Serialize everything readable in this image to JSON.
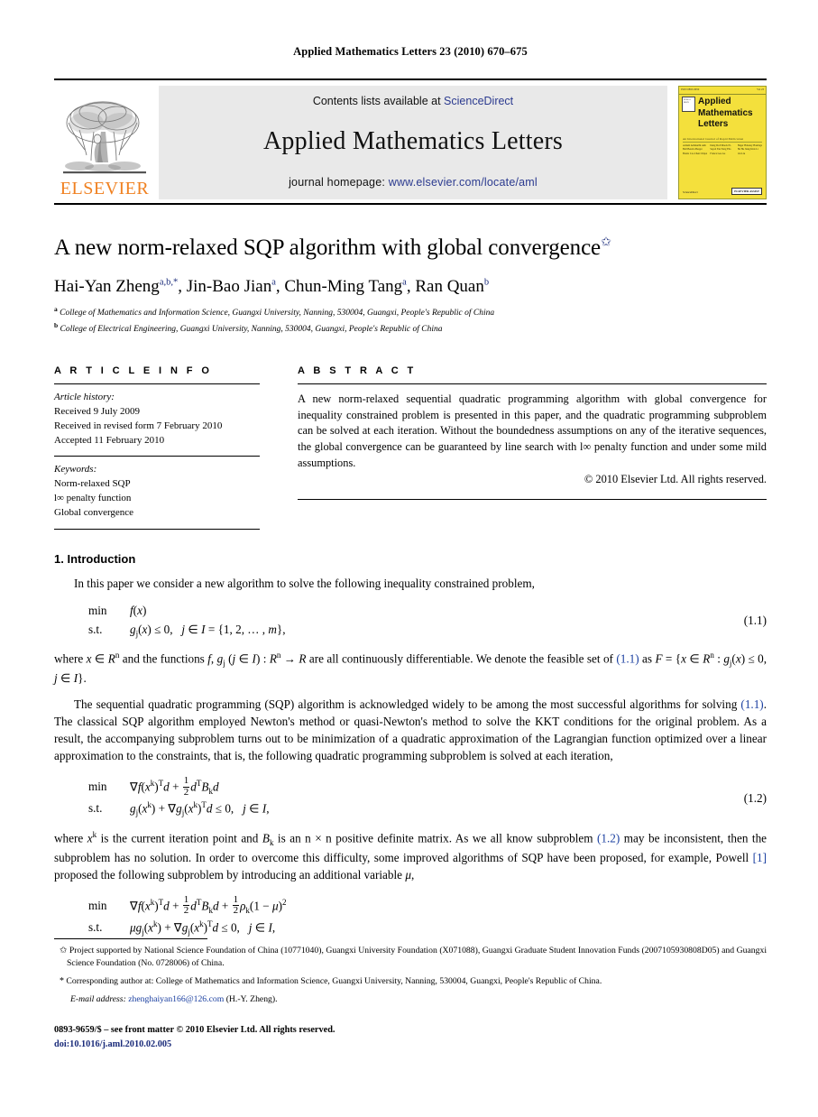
{
  "running_head": "Applied Mathematics Letters 23 (2010) 670–675",
  "masthead": {
    "contents_prefix": "Contents lists available at",
    "contents_link": "ScienceDirect",
    "journal_title": "Applied Mathematics Letters",
    "homepage_prefix": "journal homepage:",
    "homepage_url": "www.elsevier.com/locate/aml",
    "publisher_name": "ELSEVIER",
    "publisher_color": "#F08121",
    "link_color": "#2b3a8f"
  },
  "cover": {
    "background_color": "#F4E03C",
    "line1": "Applied",
    "line2": "Mathematics",
    "line3": "Letters",
    "subtitle": "An International Journal of Rapid Publication",
    "board_heading": "Editorial Board",
    "col1": "Ackleh\nAdimurthi\nAnh\nBall\nBeretta\nBerger\nBrezis\nCao\nChen\nChipot",
    "col2": "Deng\nDu\nEilbeck\nEl-Sayed\nFan\nFeng\nFila\nFranca\nGao\nGe",
    "col3": "Hager\nHalanay\nHastings\nHe\nHu\nJiang\nKirk\nLi\nLin\nLiu",
    "badge": "ELSEVIER\nASSIST",
    "sd_label": "ScienceDirect"
  },
  "article": {
    "title": "A new norm-relaxed SQP algorithm with global convergence",
    "title_marker": "✩",
    "authors": [
      {
        "name": "Hai-Yan Zheng",
        "sup": "a,b,*"
      },
      {
        "name": "Jin-Bao Jian",
        "sup": "a"
      },
      {
        "name": "Chun-Ming Tang",
        "sup": "a"
      },
      {
        "name": "Ran Quan",
        "sup": "b"
      }
    ],
    "affiliations": [
      {
        "mark": "a",
        "text": "College of Mathematics and Information Science, Guangxi University, Nanning, 530004, Guangxi, People's Republic of China"
      },
      {
        "mark": "b",
        "text": "College of Electrical Engineering, Guangxi University, Nanning, 530004, Guangxi, People's Republic of China"
      }
    ]
  },
  "article_info": {
    "heading": "A R T I C L E    I N F O",
    "history_label": "Article history:",
    "history": [
      "Received 9 July 2009",
      "Received in revised form 7 February 2010",
      "Accepted 11 February 2010"
    ],
    "keywords_label": "Keywords:",
    "keywords": [
      "Norm-relaxed SQP",
      "l∞ penalty function",
      "Global convergence"
    ]
  },
  "abstract": {
    "heading": "A B S T R A C T",
    "text": "A new norm-relaxed sequential quadratic programming algorithm with global convergence for inequality constrained problem is presented in this paper, and the quadratic programming subproblem can be solved at each iteration. Without the boundedness assumptions on any of the iterative sequences, the global convergence can be guaranteed by line search with l∞ penalty function and under some mild assumptions.",
    "rights": "© 2010 Elsevier Ltd. All rights reserved."
  },
  "body": {
    "section_number": "1.",
    "section_title": "Introduction",
    "para1": "In this paper we consider a new algorithm to solve the following inequality constrained problem,",
    "eq11": {
      "number": "(1.1)",
      "min_label": "min",
      "min_expr": "f(x)",
      "st_label": "s.t.",
      "st_expr": "gⱼ(x) ≤ 0,   j ∈ I = {1, 2, … , m},"
    },
    "para2_pre": "where x ∈ R",
    "para2": "where x ∈ Rⁿ and the functions f, gⱼ (j ∈ I) : Rⁿ → R are all continuously differentiable. We denote the feasible set of (1.1) as F = {x ∈ Rⁿ : gⱼ(x) ≤ 0, j ∈ I}.",
    "para3": "The sequential quadratic programming (SQP) algorithm is acknowledged widely to be among the most successful algorithms for solving (1.1). The classical SQP algorithm employed Newton's method or quasi-Newton's method to solve the KKT conditions for the original problem. As a result, the accompanying subproblem turns out to be minimization of a quadratic approximation of the Lagrangian function optimized over a linear approximation to the constraints, that is, the following quadratic programming subproblem is solved at each iteration,",
    "eq12": {
      "number": "(1.2)",
      "min_label": "min",
      "st_label": "s.t."
    },
    "para4": "where xᵏ is the current iteration point and Bₖ is an n × n positive definite matrix. As we all know subproblem (1.2) may be inconsistent, then the subproblem has no solution. In order to overcome this difficulty, some improved algorithms of SQP have been proposed, for example, Powell [1] proposed the following subproblem by introducing an additional variable μ,",
    "eq13": {
      "min_label": "min",
      "st_label": "s.t."
    },
    "ref_11": "(1.1)",
    "ref_12": "(1.2)",
    "ref_1": "[1]"
  },
  "footnotes": {
    "star_mark": "✩",
    "star_text": "Project supported by National Science Foundation of China (10771040), Guangxi University Foundation (X071088), Guangxi Graduate Student Innovation Funds (2007105930808D05) and Guangxi Science Foundation (No. 0728006) of China.",
    "corr_mark": "*",
    "corr_text": "Corresponding author at: College of Mathematics and Information Science, Guangxi University, Nanning, 530004, Guangxi, People's Republic of China.",
    "email_label": "E-mail address:",
    "email": "zhenghaiyan166@126.com",
    "email_suffix": "(H.-Y. Zheng).",
    "email_color": "#1a3fa0"
  },
  "colophon": {
    "issn_line": "0893-9659/$ – see front matter © 2010 Elsevier Ltd. All rights reserved.",
    "doi_line": "doi:10.1016/j.aml.2010.02.005"
  }
}
